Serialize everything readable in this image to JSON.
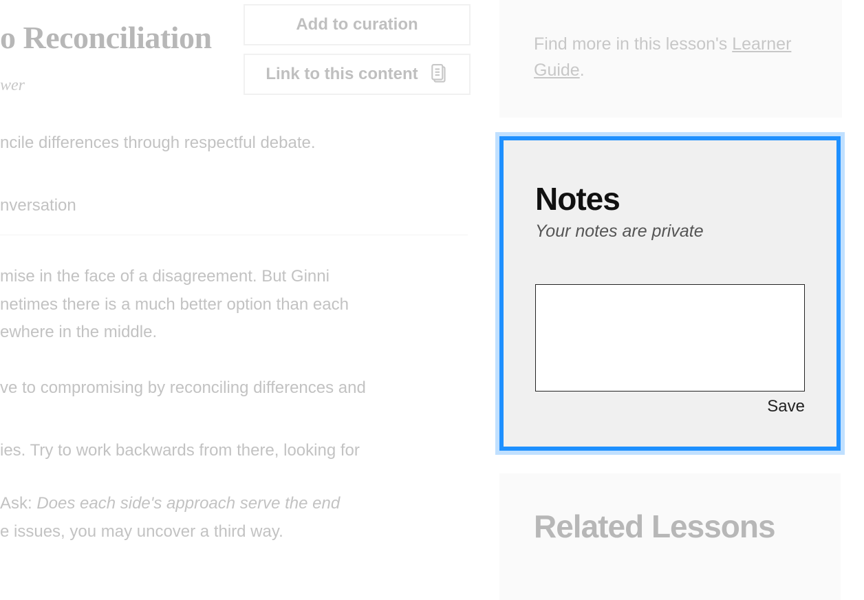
{
  "main": {
    "title_fragment": "o Reconciliation",
    "subtitle_fragment": "wer",
    "lead_fragment": "ncile differences through respectful debate.",
    "subheading_fragment": "nversation",
    "para1_l1": "mise in the face of a disagreement. But Ginni",
    "para1_l2": "netimes there is a much better option than each",
    "para1_l3": "ewhere in the middle.",
    "para2": "ve to compromising by reconciling differences and",
    "para3": "ies. Try to work backwards from there, looking for",
    "para4_prefix": "Ask: ",
    "para4_italic": "Does each side's approach serve the end",
    "para4_line2": "e issues, you may uncover a third way."
  },
  "buttons": {
    "add_to_curation": "Add to curation",
    "link_to_content": "Link to this content"
  },
  "learner_guide": {
    "prefix": "Find more in this lesson's ",
    "link_text": "Learner Guide",
    "suffix": "."
  },
  "notes": {
    "title": "Notes",
    "subtitle": "Your notes are private",
    "value": "",
    "save_label": "Save"
  },
  "related": {
    "title": "Related Lessons"
  }
}
